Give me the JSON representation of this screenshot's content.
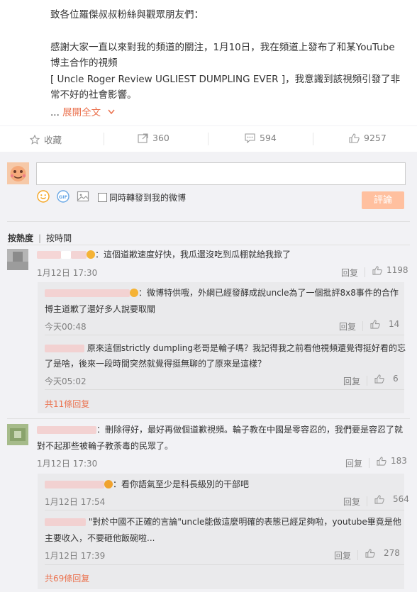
{
  "post": {
    "greeting": "致各位羅傑叔叔粉絲與觀眾朋友們：",
    "line1": "感謝大家一直以來對我的頻道的關注，1月10日，我在頻道上發布了和某YouTube",
    "line2": "博主合作的視頻",
    "line3": "[ Uncle Roger Review UGLIEST DUMPLING EVER ]，我意識到該視頻引發了非",
    "line4": "常不好的社會影響。",
    "ellipsis": "...",
    "expand": "展開全文"
  },
  "actions": {
    "favorite": "收藏",
    "repost_count": "360",
    "comment_count": "594",
    "like_count": "9257"
  },
  "compose": {
    "placeholder": "",
    "repost_label": "同時轉發到我的微博",
    "submit": "評論"
  },
  "sort": {
    "hot": "按熱度",
    "time": "按時間"
  },
  "comments": [
    {
      "text": "：這個道歉速度好快，我瓜還沒吃到瓜棚就給我掀了",
      "time": "1月12日 17:30",
      "reply": "回复",
      "likes": "1198",
      "subs": [
        {
          "line1": "：微博特供哦，外網已經發酵成說uncle為了一個批評8x8事件的合作",
          "line2": "博主道歉了還好多人說要取關",
          "time": "今天00:48",
          "reply": "回复",
          "likes": "14"
        },
        {
          "line1": "原來這個strictly dumpling老哥是輪子嗎？我記得我之前看他視頻還覺得挺好看的忘",
          "line2": "了是啥，後來一段時間突然就覺得挺無聊的了原來是這樣？",
          "time": "今天05:02",
          "reply": "回复",
          "likes": "6"
        }
      ],
      "more": "共11條回复"
    },
    {
      "line1": "：刪除得好，最好再做個道歉視頻。輪子教在中國是零容忍的，我們要是容忍了就",
      "line2": "對不起那些被輪子教荼毒的民眾了。",
      "time": "1月12日 17:30",
      "reply": "回复",
      "likes": "183",
      "subs": [
        {
          "line1": "：看你語氣至少是科長級別的干部吧",
          "time": "1月12日 17:54",
          "reply": "回复",
          "likes": "564"
        },
        {
          "line1": "\"對於中國不正確的言論\"uncle能做這麼明確的表態已經足夠啦，youtube畢竟是他",
          "line2": "主要收入，不要砸他飯碗啦...",
          "time": "1月12日 17:39",
          "reply": "回复",
          "likes": "278"
        }
      ],
      "more": "共69條回复"
    }
  ]
}
